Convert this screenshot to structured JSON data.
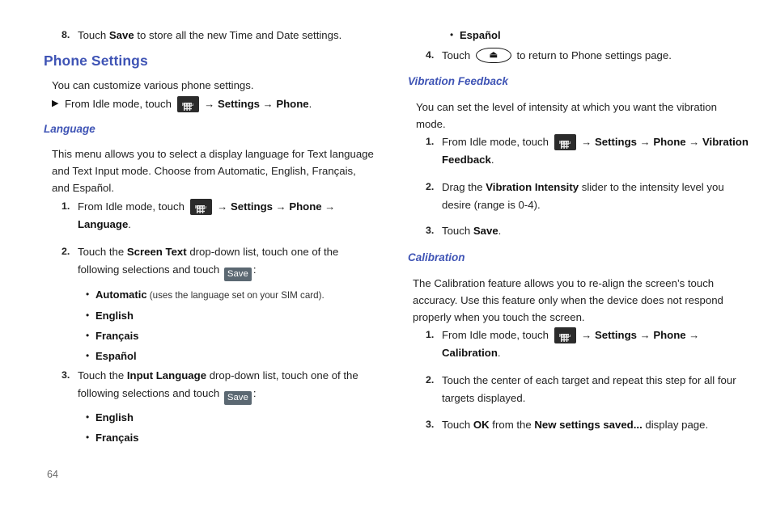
{
  "page": {
    "number": "64",
    "icons": {
      "menu": "menu-grid-icon",
      "menu_label": "Menu",
      "back": "back-arrow-icon",
      "back_glyph": "⏏"
    }
  },
  "left_column": {
    "step8": {
      "num": "8.",
      "t1": "Touch ",
      "b1": "Save",
      "t2": " to store all the new Time and Date settings."
    },
    "heading_phone_settings": "Phone Settings",
    "intro": "You can customize various phone settings.",
    "idle_row": {
      "bullet": "▶",
      "t1": "From Idle mode, touch ",
      "arrow1": "→",
      "b1": "Settings",
      "arrow2": "→",
      "b2": "Phone",
      "t2": "."
    },
    "heading_language": "Language",
    "language_intro": "This menu allows you to select a display language for Text language and Text Input mode. Choose from Automatic, English, Français, and Español.",
    "steps": [
      {
        "num": "1.",
        "t1": "From Idle mode, touch ",
        "arrow1": "→",
        "b1": "Settings",
        "arrow2": "→",
        "b2": "Phone",
        "arrow3": "→",
        "b3": "Language",
        "t2": "."
      },
      {
        "num": "2.",
        "t1": "Touch the ",
        "b1": "Screen Text",
        "t2": " drop-down list, touch one of the following selections and touch ",
        "chip": "Save",
        "t3": ":"
      },
      {
        "num": "3.",
        "t1": "Touch the ",
        "b1": "Input Language",
        "t2": " drop-down list, touch one of the following selections and touch ",
        "chip": "Save",
        "t3": ":"
      }
    ],
    "screen_text_options": [
      {
        "label": "Automatic",
        "note": " (uses the language set on your SIM card)."
      },
      {
        "label": "English",
        "note": ""
      },
      {
        "label": "Français",
        "note": ""
      },
      {
        "label": "Español",
        "note": ""
      }
    ],
    "input_language_options": [
      {
        "label": "English",
        "note": ""
      },
      {
        "label": "Français",
        "note": ""
      }
    ],
    "bullet_dot": "•"
  },
  "right_column": {
    "continued_option": {
      "label": "Español",
      "note": ""
    },
    "step4": {
      "num": "4.",
      "t1": "Touch ",
      "t2": " to return to Phone settings page."
    },
    "heading_vibration": "Vibration Feedback",
    "vibration_intro": "You can set the level of intensity at which you want the vibration mode.",
    "vibration_steps": [
      {
        "num": "1.",
        "t1": "From Idle mode, touch ",
        "arrow1": "→",
        "b1": "Settings",
        "arrow2": "→",
        "b2": "Phone",
        "arrow3": "→",
        "b3": "Vibration Feedback",
        "t2": "."
      },
      {
        "num": "2.",
        "t1": "Drag the ",
        "b1": "Vibration Intensity",
        "t2": " slider to the intensity level you desire (range is 0-4)."
      },
      {
        "num": "3.",
        "t1": "Touch ",
        "b1": "Save",
        "t2": "."
      }
    ],
    "heading_calibration": "Calibration",
    "calibration_intro": "The Calibration feature allows you to re-align the screen’s touch accuracy. Use this feature only when the device does not respond properly when you touch the screen.",
    "calibration_steps": [
      {
        "num": "1.",
        "t1": "From Idle mode, touch ",
        "arrow1": "→",
        "b1": "Settings",
        "arrow2": "→",
        "b2": "Phone",
        "arrow3": "→",
        "b3": "Calibration",
        "t2": "."
      },
      {
        "num": "2.",
        "t1": "Touch the center of each target and repeat this step for all four targets displayed."
      },
      {
        "num": "3.",
        "t1": "Touch ",
        "b1": "OK",
        "t2": " from the ",
        "b2": "New settings saved...",
        "t3": " display page."
      }
    ],
    "bullet_dot": "•"
  },
  "colors": {
    "heading_blue": "#3f54b5",
    "chip_bg": "#5b6872",
    "icon_dark": "#2b2b2b",
    "body_text": "#222222",
    "folio": "#6a6a6a"
  }
}
